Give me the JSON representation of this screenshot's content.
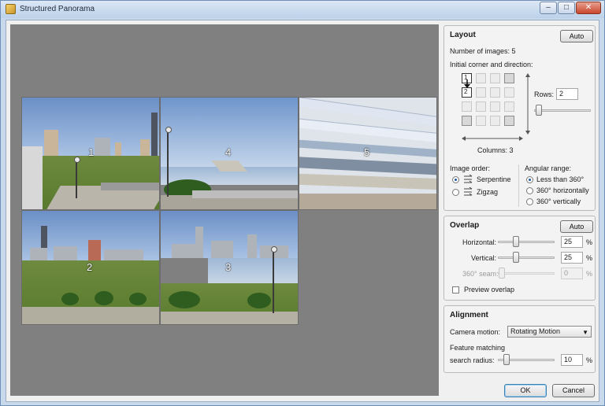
{
  "window": {
    "title": "Structured Panorama",
    "minimize_glyph": "–",
    "maximize_glyph": "□",
    "close_glyph": "✕"
  },
  "tiles": [
    {
      "number": "1"
    },
    {
      "number": "4"
    },
    {
      "number": "5"
    },
    {
      "number": "2"
    },
    {
      "number": "3"
    }
  ],
  "layout": {
    "title": "Layout",
    "auto_label": "Auto",
    "image_count_text": "Number of images: 5",
    "corner_label": "Initial corner and direction:",
    "grid_numbers": [
      "1",
      "2"
    ],
    "rows_label": "Rows:",
    "rows_value": "2",
    "columns_text": "Columns: 3",
    "image_order_label": "Image order:",
    "order_options": [
      {
        "label": "Serpentine",
        "selected": true
      },
      {
        "label": "Zigzag",
        "selected": false
      }
    ],
    "angular_label": "Angular range:",
    "angular_options": [
      {
        "label": "Less than 360°",
        "selected": true
      },
      {
        "label": "360° horizontally",
        "selected": false
      },
      {
        "label": "360° vertically",
        "selected": false
      }
    ]
  },
  "overlap": {
    "title": "Overlap",
    "auto_label": "Auto",
    "horizontal_label": "Horizontal:",
    "horizontal_value": "25",
    "vertical_label": "Vertical:",
    "vertical_value": "25",
    "seam_label": "360° seam:",
    "seam_value": "0",
    "percent": "%",
    "preview_label": "Preview overlap",
    "preview_checked": false
  },
  "alignment": {
    "title": "Alignment",
    "camera_label": "Camera motion:",
    "camera_value": "Rotating Motion",
    "feature_label": "Feature matching",
    "radius_label": "search radius:",
    "radius_value": "10",
    "percent": "%"
  },
  "footer": {
    "ok_label": "OK",
    "cancel_label": "Cancel"
  }
}
